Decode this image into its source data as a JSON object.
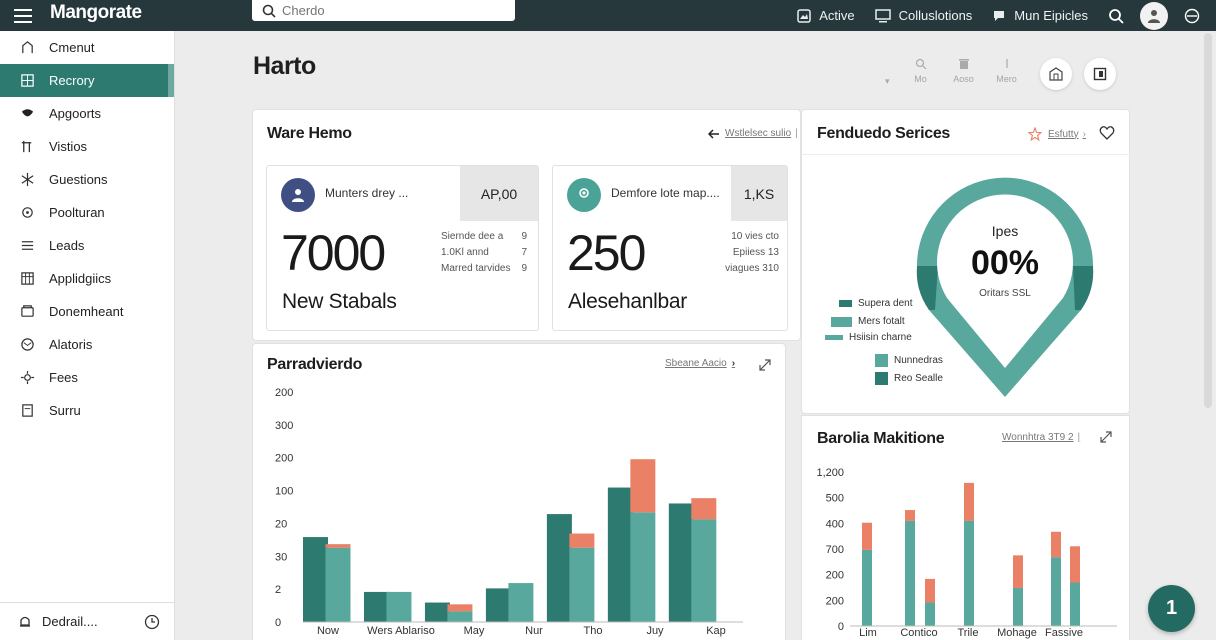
{
  "app": {
    "brand": "Mangorate",
    "search_placeholder": "Cherdo",
    "top_links": [
      "Active",
      "Colluslotions",
      "Mun Eipicles"
    ]
  },
  "sidebar": {
    "items": [
      {
        "label": "Cmenut",
        "icon": "home-icon"
      },
      {
        "label": "Recrory",
        "icon": "grid-icon",
        "active": true
      },
      {
        "label": "Apgoorts",
        "icon": "shield-icon"
      },
      {
        "label": "Vistios",
        "icon": "flag-icon"
      },
      {
        "label": "Guestions",
        "icon": "sparkle-icon"
      },
      {
        "label": "Poolturan",
        "icon": "gear-icon"
      },
      {
        "label": "Leads",
        "icon": "list-icon"
      },
      {
        "label": "Applidgiics",
        "icon": "table-icon"
      },
      {
        "label": "Donemheant",
        "icon": "folder-icon"
      },
      {
        "label": "Alatoris",
        "icon": "globe-icon"
      },
      {
        "label": "Fees",
        "icon": "settings-icon"
      },
      {
        "label": "Surru",
        "icon": "doc-icon"
      }
    ],
    "footer_label": "Dedrail...."
  },
  "page": {
    "title": "Harto",
    "tools": [
      "Mo",
      "Aoso",
      "Mero"
    ]
  },
  "ware": {
    "title": "Ware Hemo",
    "link": "Wstlelsec sulio",
    "stat1": {
      "label": "Munters drey ...",
      "box": "AP,00",
      "value": "7000",
      "sub": "New Stabals",
      "meta": [
        [
          "Siernde dee a",
          "9"
        ],
        [
          "1.0Kl annd",
          "7"
        ],
        [
          "Marred tarvides",
          "9"
        ]
      ]
    },
    "stat2": {
      "label": "Demfore lote map....",
      "box": "1,KS",
      "value": "250",
      "sub": "Alesehanlbar",
      "meta": [
        [
          "10 vies cto",
          ""
        ],
        [
          "Epiiess 13",
          ""
        ],
        [
          "viagues 310",
          ""
        ]
      ]
    }
  },
  "para": {
    "title": "Parradvierdo",
    "link": "Sbeane Aacio"
  },
  "fenduedo": {
    "title": "Fenduedo Serices",
    "link": "Esfutty",
    "donut_label": "Ipes",
    "donut_value": "00%",
    "donut_sub": "Oritars SSL",
    "legend": [
      "Supera dent",
      "Mers fotalt",
      "Hsiisin charne",
      "Nunnedras",
      "Reo Sealle"
    ]
  },
  "barolia": {
    "title": "Barolia Makitione",
    "link": "Wonnhtra 3T9 2"
  },
  "colors": {
    "dark_teal": "#2d7a70",
    "teal": "#58a89d",
    "coral": "#ea8066",
    "top_bar": "#26383c"
  },
  "chart_data": [
    {
      "type": "bar",
      "title": "Parradvierdo",
      "y_tick_labels": [
        "200",
        "300",
        "200",
        "100",
        "20",
        "30",
        "2",
        "0"
      ],
      "categories": [
        "Now",
        "Wers Ablariso",
        "May",
        "Nur",
        "Tho",
        "Juy",
        "Kap"
      ],
      "series": [
        {
          "values": [
            240,
            240,
            240,
            40,
            40,
            240,
            260,
            520,
            520,
            630,
            510,
            430,
            430
          ]
        },
        {
          "values": [
            0,
            210,
            0,
            0,
            0,
            0,
            0,
            0,
            330,
            0,
            120,
            0,
            190
          ]
        },
        {
          "values": [
            0,
            0,
            0,
            0,
            0,
            0,
            0,
            0,
            0,
            0,
            0,
            0,
            0
          ]
        }
      ],
      "stack": [
        {
          "dark": 240,
          "teal": 0,
          "coral": 0
        },
        {
          "dark": 0,
          "teal": 210,
          "coral": 10
        },
        {
          "dark": 85,
          "teal": 0,
          "coral": 0
        },
        {
          "dark": 0,
          "teal": 85,
          "coral": 0
        },
        {
          "dark": 55,
          "teal": 0,
          "coral": 0
        },
        {
          "dark": 0,
          "teal": 30,
          "coral": 20
        },
        {
          "dark": 95,
          "teal": 0,
          "coral": 0
        },
        {
          "dark": 0,
          "teal": 110,
          "coral": 0
        },
        {
          "dark": 305,
          "teal": 0,
          "coral": 0
        },
        {
          "dark": 0,
          "teal": 210,
          "coral": 40
        },
        {
          "dark": 380,
          "teal": 0,
          "coral": 0
        },
        {
          "dark": 0,
          "teal": 310,
          "coral": 150
        },
        {
          "dark": 335,
          "teal": 0,
          "coral": 0
        },
        {
          "dark": 0,
          "teal": 290,
          "coral": 60
        }
      ]
    },
    {
      "type": "bar",
      "title": "Barolia Makitione",
      "y_tick_labels": [
        "1,200",
        "500",
        "400",
        "700",
        "200",
        "200",
        "0"
      ],
      "categories": [
        "Lim",
        "Contico",
        "Trile",
        "Mohage",
        "Fassive"
      ],
      "stack": [
        {
          "teal": 420,
          "coral": 150
        },
        {
          "teal": 580,
          "coral": 60
        },
        {
          "teal": 130,
          "coral": 130
        },
        {
          "teal": 580,
          "coral": 210
        },
        {
          "teal": 210,
          "coral": 180
        },
        {
          "teal": 380,
          "coral": 140
        },
        {
          "teal": 240,
          "coral": 200
        }
      ]
    }
  ]
}
